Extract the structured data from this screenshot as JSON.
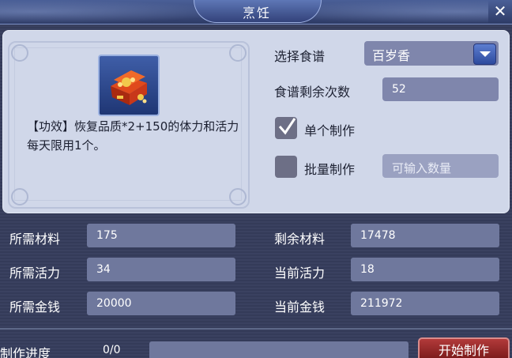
{
  "window": {
    "title": "烹饪"
  },
  "recipe": {
    "description": "【功效】恢复品质*2+150的体力和活力每天限用1个。"
  },
  "options": {
    "select_label": "选择食谱",
    "selected_recipe": "百岁香",
    "remaining_label": "食谱剩余次数",
    "remaining_value": "52",
    "single_label": "单个制作",
    "single_checked": true,
    "batch_label": "批量制作",
    "batch_checked": false,
    "batch_placeholder": "可输入数量"
  },
  "stats": {
    "req_material_label": "所需材料",
    "req_material": "175",
    "left_material_label": "剩余材料",
    "left_material": "17478",
    "req_vitality_label": "所需活力",
    "req_vitality": "34",
    "cur_vitality_label": "当前活力",
    "cur_vitality": "18",
    "req_money_label": "所需金钱",
    "req_money": "20000",
    "cur_money_label": "当前金钱",
    "cur_money": "211972"
  },
  "footer": {
    "progress_label": "制作进度",
    "progress_text": "0/0",
    "progress_fraction": 0,
    "start_label": "开始制作"
  },
  "colors": {
    "accent": "#4a5f97",
    "button": "#8f2222",
    "field": "#7f86ac"
  },
  "icons": {
    "close": "close-icon",
    "dropdown": "chevron-down-icon",
    "check": "checkmark-icon",
    "item": "treasure-chest-icon"
  }
}
